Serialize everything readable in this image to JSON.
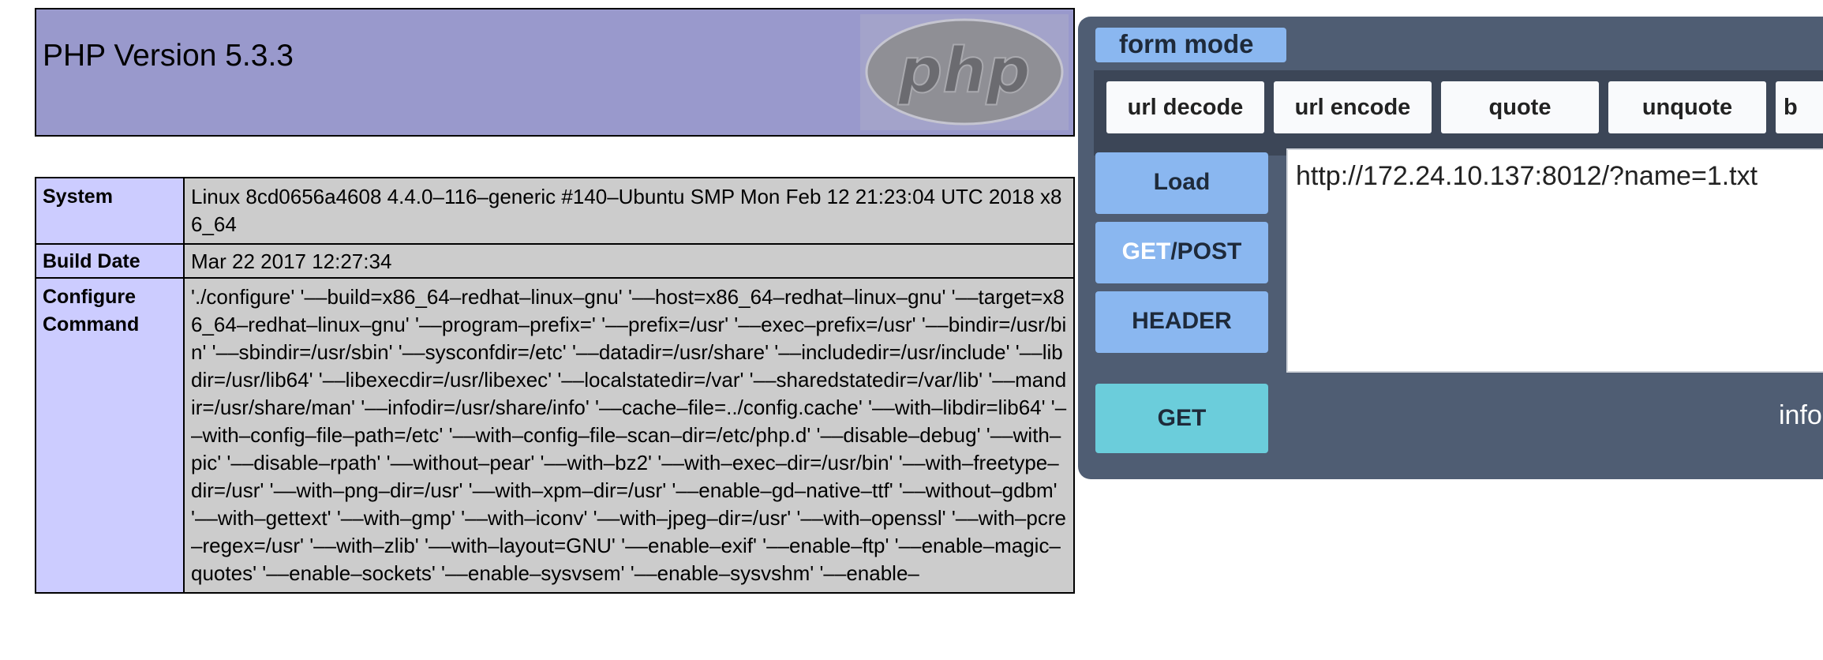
{
  "phpinfo": {
    "title": "PHP Version 5.3.3",
    "logo_text": "php",
    "rows": [
      {
        "key": "System",
        "value": "Linux 8cd0656a4608 4.4.0–116–generic #140–Ubuntu SMP Mon Feb 12 21:23:04 UTC 2018 x86_64"
      },
      {
        "key": "Build Date",
        "value": "Mar 22 2017 12:27:34"
      },
      {
        "key": "Configure Command",
        "value": "'./configure' '––build=x86_64–redhat–linux–gnu' '––host=x86_64–redhat–linux–gnu' '––target=x86_64–redhat–linux–gnu' '––program–prefix=' '––prefix=/usr' '––exec–prefix=/usr' '––bindir=/usr/bin' '––sbindir=/usr/sbin' '––sysconfdir=/etc' '––datadir=/usr/share' '––includedir=/usr/include' '––libdir=/usr/lib64' '––libexecdir=/usr/libexec' '––localstatedir=/var' '––sharedstatedir=/var/lib' '––mandir=/usr/share/man' '––infodir=/usr/share/info' '––cache–file=../config.cache' '––with–libdir=lib64' '––with–config–file–path=/etc' '––with–config–file–scan–dir=/etc/php.d' '––disable–debug' '––with–pic' '––disable–rpath' '––without–pear' '––with–bz2' '––with–exec–dir=/usr/bin' '––with–freetype–dir=/usr' '––with–png–dir=/usr' '––with–xpm–dir=/usr' '––enable–gd–native–ttf' '––without–gdbm' '––with–gettext' '––with–gmp' '––with–iconv' '––with–jpeg–dir=/usr' '––with–openssl' '––with–pcre–regex=/usr' '––with–zlib' '––with–layout=GNU' '––enable–exif' '––enable–ftp' '––enable–magic–quotes' '––enable–sockets' '––enable–sysvsem' '––enable–sysvshm' '––enable–"
      }
    ]
  },
  "hackbar": {
    "mode_tab": "form mode",
    "encode_buttons": [
      "url decode",
      "url encode",
      "quote",
      "unquote",
      "b"
    ],
    "load_label": "Load",
    "method_get": "GET",
    "method_sep_post": "/POST",
    "header_label": "HEADER",
    "url_value": "http://172.24.10.137:8012/?name=1.txt",
    "send_label": "GET",
    "info_label": "info"
  },
  "colors": {
    "php_header_bg": "#9999cc",
    "php_key_bg": "#ccccff",
    "php_value_bg": "#cccccc",
    "hackbar_bg": "#4f5d73",
    "hackbar_btn": "#8ab7f0",
    "hackbar_go_btn": "#6bcddb"
  }
}
